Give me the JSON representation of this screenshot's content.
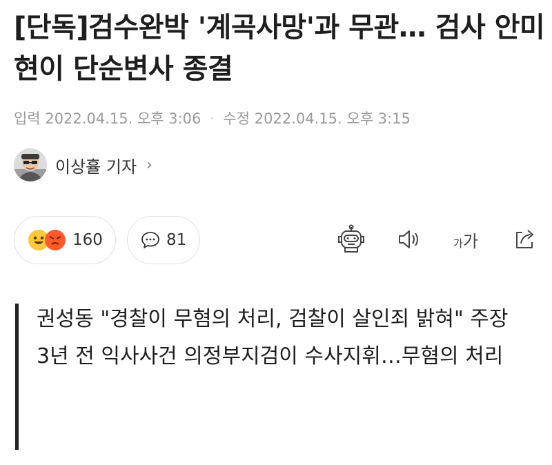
{
  "article": {
    "title": "[단독]검수완박 '계곡사망'과 무관… 검사 안미현이 단순변사 종결",
    "date_input_label": "입력",
    "date_input": "2022.04.15. 오후 3:06",
    "date_sep": "·",
    "date_edit_label": "수정",
    "date_edit": "2022.04.15. 오후 3:15"
  },
  "reporter": {
    "name": "이상휼 기자",
    "chevron": "›"
  },
  "reactions": {
    "count": "160"
  },
  "comments": {
    "count": "81"
  },
  "tools": {
    "font_size_small": "가",
    "font_size_large": "가"
  },
  "summary": {
    "lines": [
      "권성동 \"경찰이 무혐의 처리, 검찰이 살인죄 밝혀\" 주장",
      "3년 전 익사사건 의정부지검이 수사지휘…무혐의 처리"
    ]
  },
  "icons": [
    "happy-emoji-icon",
    "angry-emoji-icon",
    "comment-bubble-icon",
    "robot-summary-icon",
    "speaker-icon",
    "font-size-icon",
    "share-icon"
  ],
  "colors": {
    "happy": "#ffc83d",
    "angry": "#ff5a2c",
    "date": "#9a9a9a",
    "bar": "#222222"
  }
}
